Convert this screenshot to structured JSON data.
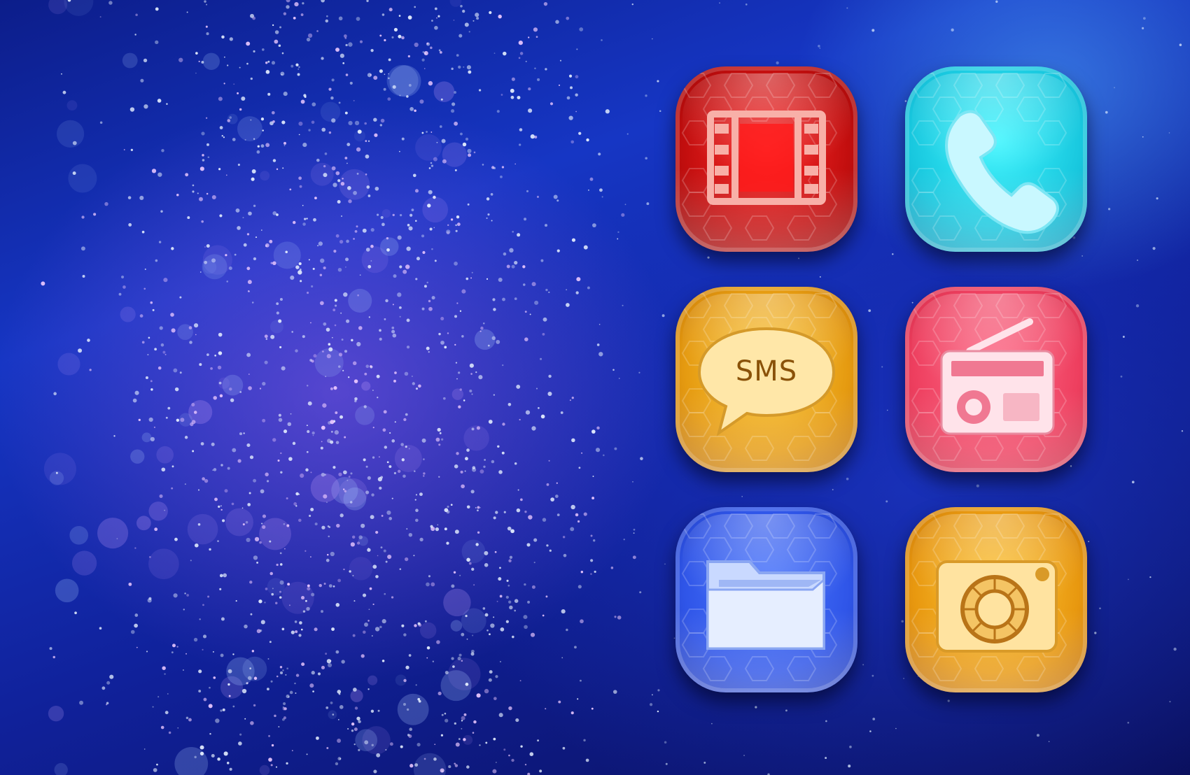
{
  "home_screen": {
    "apps": [
      {
        "id": "video",
        "icon": "video-film-icon",
        "color": "#d81414"
      },
      {
        "id": "phone",
        "icon": "phone-icon",
        "color": "#22d3ea"
      },
      {
        "id": "sms",
        "icon": "sms-icon",
        "color": "#f0a81a",
        "label": "SMS"
      },
      {
        "id": "radio",
        "icon": "radio-icon",
        "color": "#f04b6a"
      },
      {
        "id": "folder",
        "icon": "folder-icon",
        "color": "#3360f0"
      },
      {
        "id": "camera",
        "icon": "camera-icon",
        "color": "#f0a418"
      }
    ]
  },
  "theme": {
    "background": "#1230b0"
  }
}
